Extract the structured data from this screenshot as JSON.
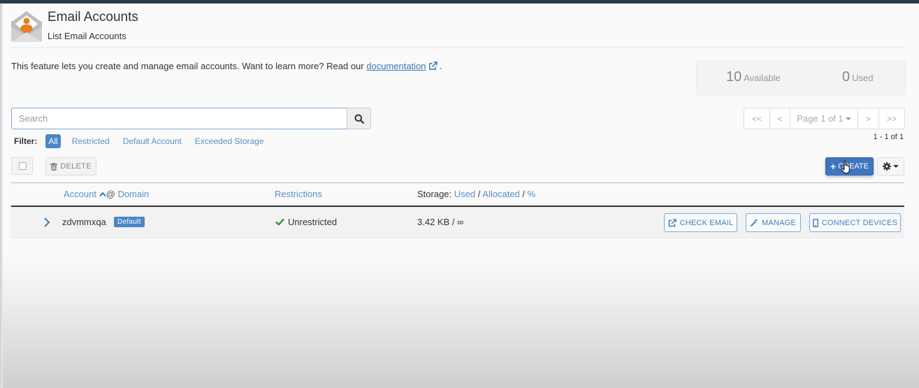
{
  "header": {
    "title": "Email Accounts",
    "subtitle": "List Email Accounts",
    "icon": "envelope-user-icon"
  },
  "description": {
    "text": "This feature lets you create and manage email accounts. Want to learn more? Read our ",
    "link_label": "documentation",
    "link_icon": "external-link-icon",
    "suffix": " ."
  },
  "stats": {
    "available_count": "10",
    "available_label": "Available",
    "used_count": "0",
    "used_label": "Used"
  },
  "search": {
    "placeholder": "Search",
    "value": "",
    "button_icon": "search-icon"
  },
  "filter": {
    "label": "Filter:",
    "options": [
      {
        "label": "All",
        "active": true
      },
      {
        "label": "Restricted",
        "active": false
      },
      {
        "label": "Default Account",
        "active": false
      },
      {
        "label": "Exceeded Storage",
        "active": false
      }
    ]
  },
  "pagination": {
    "first": "<<",
    "prev": "<",
    "page_label": "Page 1 of 1",
    "next": ">",
    "last": ">>",
    "range": "1 - 1 of 1"
  },
  "toolbar": {
    "delete_label": "DELETE",
    "create_label": "CREATE",
    "create_icon": "plus-icon",
    "settings_icon": "gear-icon"
  },
  "table": {
    "columns": {
      "account": "Account",
      "at": "@",
      "domain": "Domain",
      "restrictions": "Restrictions",
      "storage_prefix": "Storage:",
      "storage_used": "Used",
      "storage_allocated": "Allocated",
      "storage_percent": "%",
      "separator": "/"
    },
    "rows": [
      {
        "account": "zdvmmxqa",
        "badge": "Default",
        "restriction": "Unrestricted",
        "storage": "3.42 KB / ∞",
        "actions": {
          "check_email": "CHECK EMAIL",
          "manage": "MANAGE",
          "connect_devices": "CONNECT DEVICES"
        }
      }
    ]
  },
  "colors": {
    "primary": "#3f75bf",
    "link": "#5b8fc7",
    "success": "#3c8a3c",
    "icon_accent": "#e67e22"
  }
}
